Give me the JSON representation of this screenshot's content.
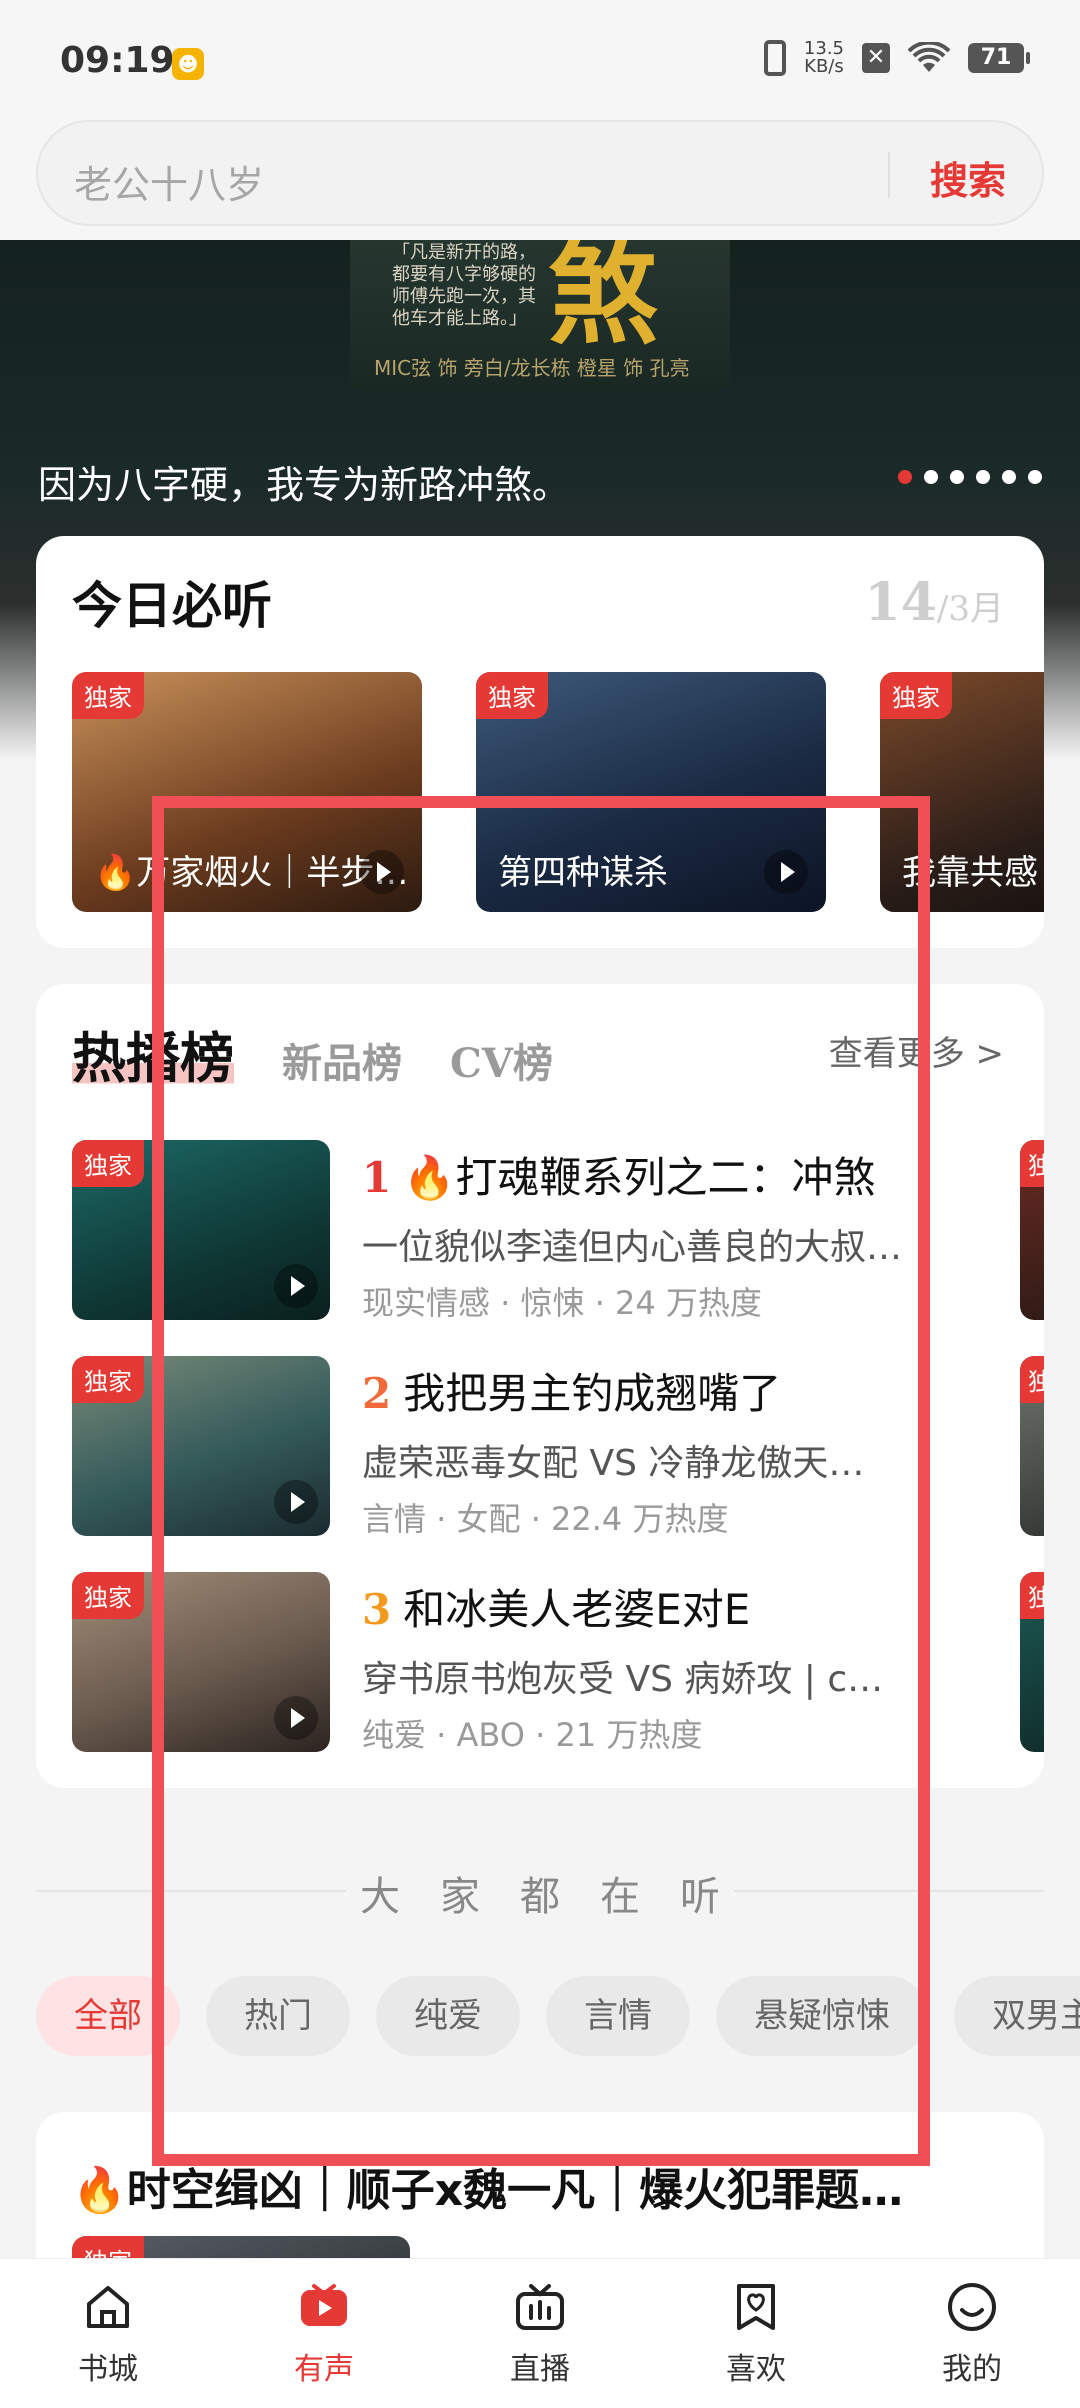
{
  "status_bar": {
    "time": "09:19",
    "net_speed_value": "13.5",
    "net_speed_unit": "KB/s",
    "battery": "71"
  },
  "search": {
    "placeholder": "老公十八岁",
    "button_label": "搜索"
  },
  "banner": {
    "poem": "「凡是新开的路，都要有八字够硬的师傅先跑一次，其他车才能上路。」",
    "glyph": "煞",
    "cast": "MIC弦 饰 旁白/龙长栋  橙星 饰 孔亮",
    "caption": "因为八字硬，我专为新路冲煞。",
    "dots_total": 6,
    "dots_active_index": 0
  },
  "today": {
    "title": "今日必听",
    "date_day": "14",
    "date_month": "/3月",
    "items": [
      {
        "tag": "独家",
        "label": "🔥万家烟火｜半步…"
      },
      {
        "tag": "独家",
        "label": "第四种谋杀"
      },
      {
        "tag": "独家",
        "label": "我靠共感"
      }
    ]
  },
  "hot": {
    "tabs": [
      "热播榜",
      "新品榜",
      "CV榜"
    ],
    "active_tab": 0,
    "see_more": "查看更多 >",
    "rows": [
      {
        "tag": "独家",
        "rank": "1",
        "title": "🔥打魂鞭系列之二：冲煞",
        "desc": "一位貌似李逵但内心善良的大叔…",
        "meta": "现实情感 · 惊悚 · 24 万热度",
        "side_tag": "独家"
      },
      {
        "tag": "独家",
        "rank": "2",
        "title": "我把男主钓成翘嘴了",
        "desc": "虚荣恶毒女配 VS 冷静龙傲天…",
        "meta": "言情 · 女配 · 22.4 万热度",
        "side_tag": "独家"
      },
      {
        "tag": "独家",
        "rank": "3",
        "title": "和冰美人老婆E对E",
        "desc": "穿书原书炮灰受 VS 病娇攻 | c…",
        "meta": "纯爱 · ABO · 21 万热度",
        "side_tag": "独家"
      }
    ]
  },
  "everyone": {
    "title": "大家都在听",
    "chips": [
      "全部",
      "热门",
      "纯爱",
      "言情",
      "悬疑惊悚",
      "双男主"
    ],
    "active_chip": 0
  },
  "feed": {
    "title": "🔥时空缉凶｜顺子x魏一凡｜爆火犯罪题…",
    "tag": "独家"
  },
  "nav": {
    "items": [
      {
        "label": "书城",
        "icon": "home-icon"
      },
      {
        "label": "有声",
        "icon": "play-video-icon"
      },
      {
        "label": "直播",
        "icon": "tv-icon"
      },
      {
        "label": "喜欢",
        "icon": "heart-bookmark-icon"
      },
      {
        "label": "我的",
        "icon": "smile-face-icon"
      }
    ],
    "active_index": 1
  },
  "colors": {
    "accent": "#e53935",
    "highlight_box": "#ef4f55"
  }
}
